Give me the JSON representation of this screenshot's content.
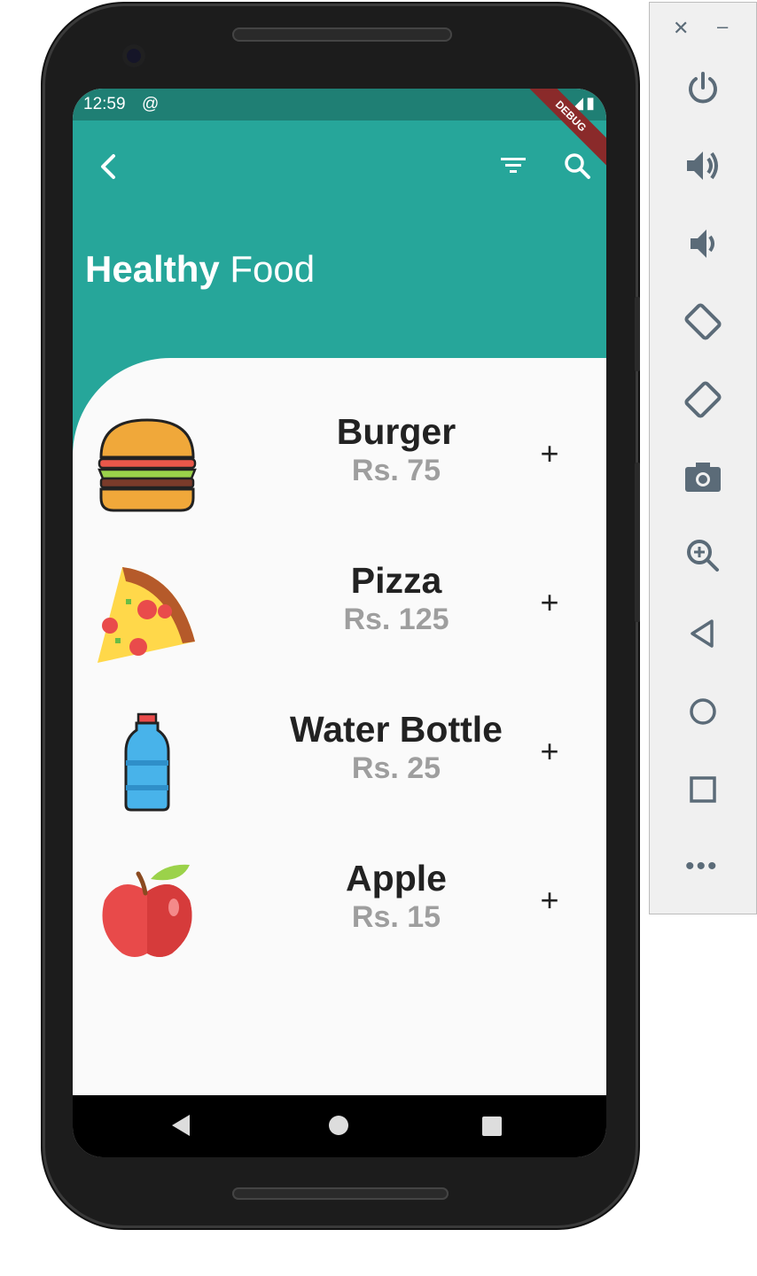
{
  "status": {
    "time": "12:59",
    "sync_icon": "@",
    "right_icons": "▾◢▮"
  },
  "appbar": {
    "title_bold": "Healthy",
    "title_regular": "Food",
    "debug_label": "DEBUG"
  },
  "items": [
    {
      "name": "Burger",
      "price": "Rs. 75",
      "icon": "burger-icon"
    },
    {
      "name": "Pizza",
      "price": "Rs. 125",
      "icon": "pizza-icon"
    },
    {
      "name": "Water Bottle",
      "price": "Rs. 25",
      "icon": "water-bottle-icon"
    },
    {
      "name": "Apple",
      "price": "Rs. 15",
      "icon": "apple-icon"
    }
  ],
  "add_label": "+",
  "emulator": {
    "close": "✕",
    "minimize": "–",
    "more": "•••"
  },
  "colors": {
    "primary": "#26a69a",
    "statusbar": "#1f7f74",
    "price_grey": "#9e9e9e"
  }
}
